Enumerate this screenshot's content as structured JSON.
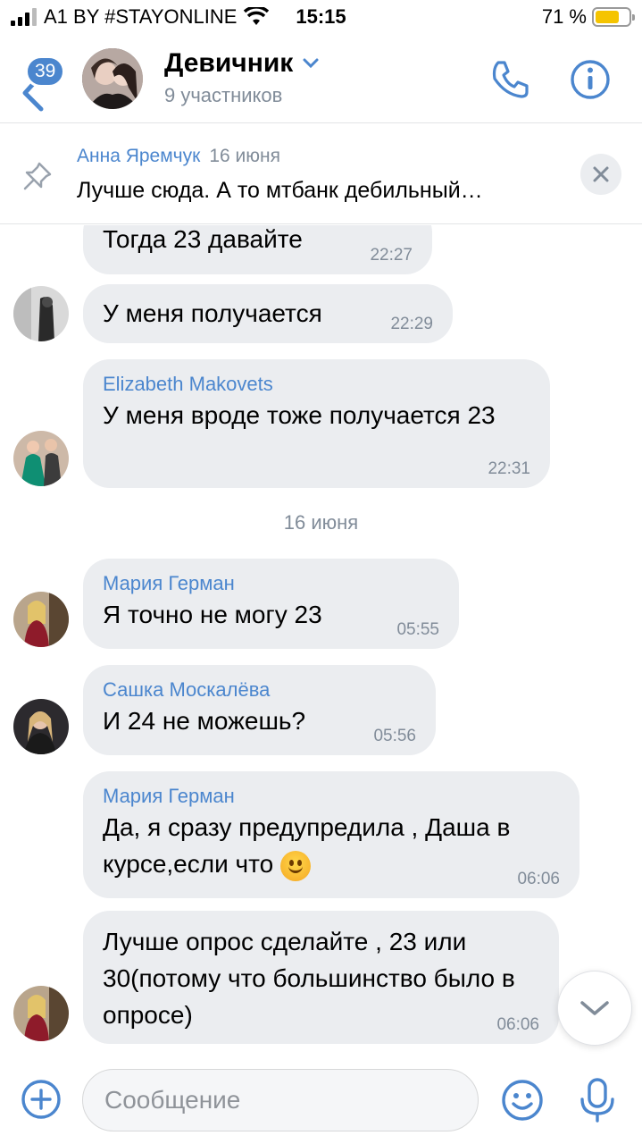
{
  "status_bar": {
    "carrier": "A1 BY #STAYONLINE",
    "time": "15:15",
    "battery": "71 %",
    "battery_level": 0.71
  },
  "header": {
    "unread_badge": "39",
    "title": "Девичник",
    "subtitle": "9 участников",
    "icons": [
      "back-arrow-icon",
      "chevron-down-icon",
      "phone-icon",
      "info-icon"
    ]
  },
  "pinned": {
    "author": "Анна Яремчук",
    "date": "16 июня",
    "text": "Лучше сюда. А то мтбанк дебильный…"
  },
  "messages": [
    {
      "author": "",
      "text": "Тогда 23 давайте",
      "time": "22:27"
    },
    {
      "author": "",
      "text": "У меня получается",
      "time": "22:29"
    },
    {
      "author": "Elizabeth Makovets",
      "text": "У меня вроде тоже получается 23",
      "time": "22:31"
    },
    {
      "author": "Мария Герман",
      "text": "Я точно не могу 23",
      "time": "05:55"
    },
    {
      "author": "Сашка Москалёва",
      "text": "И 24 не можешь?",
      "time": "05:56"
    },
    {
      "author": "Мария Герман",
      "text": "Да, я сразу предупредила , Даша в курсе,если что",
      "time": "06:06"
    },
    {
      "author": "",
      "text": "Лучше опрос сделайте , 23 или 30(потому что большинство было в опросе)",
      "time": "06:06"
    }
  ],
  "date_separator": "16 июня",
  "input": {
    "placeholder": "Сообщение"
  },
  "colors": {
    "accent": "#4b86ce",
    "bubble": "#ebedf0",
    "muted": "#818c99"
  }
}
